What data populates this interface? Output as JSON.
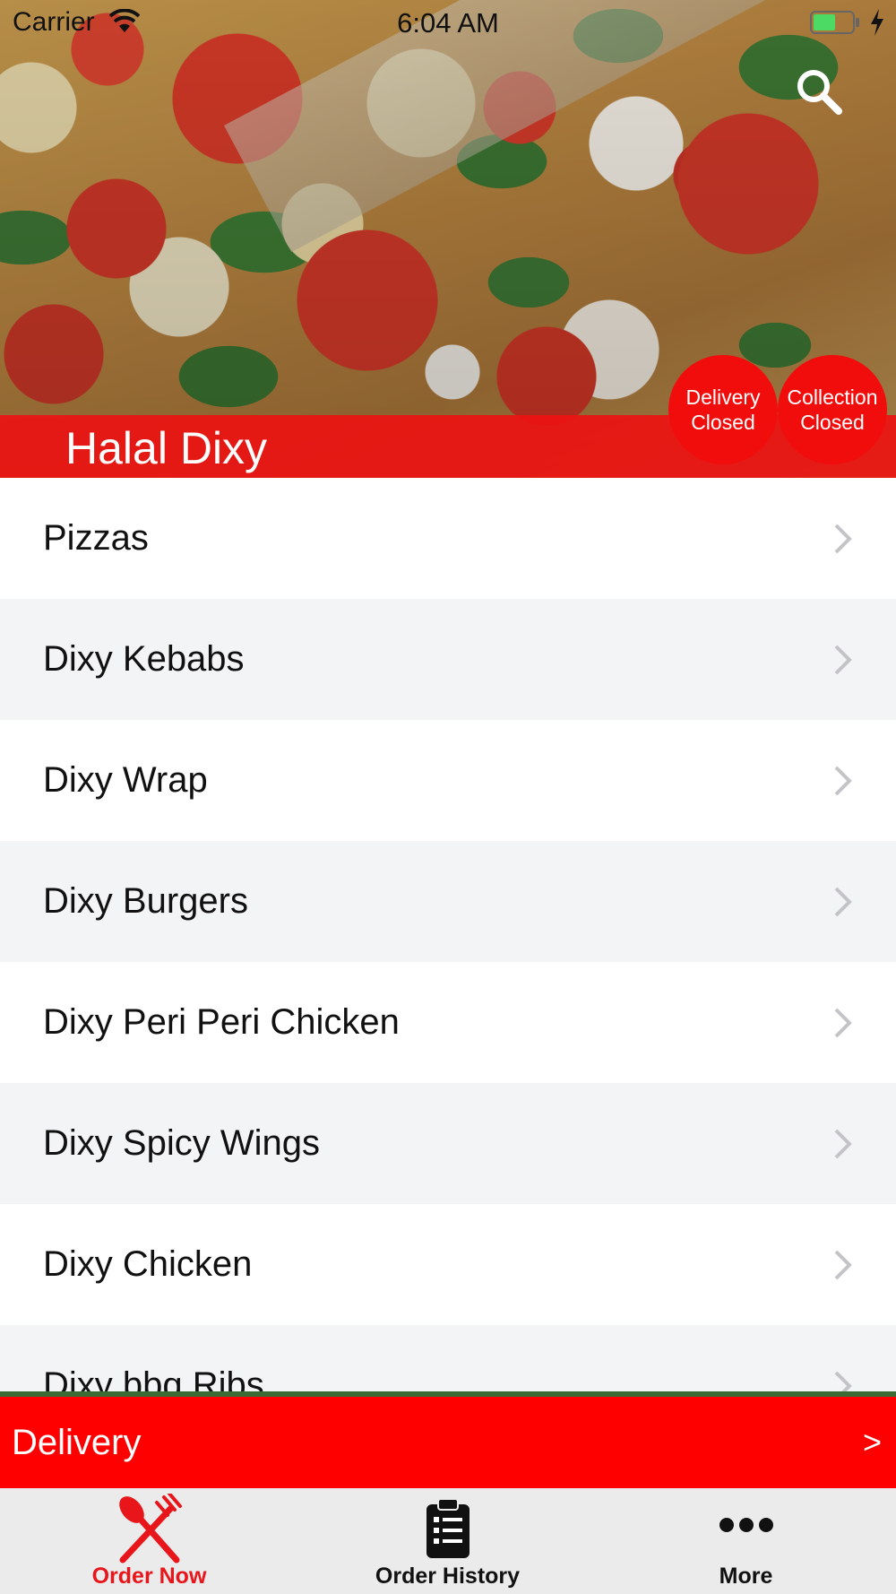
{
  "status_bar": {
    "carrier": "Carrier",
    "time": "6:04 AM",
    "battery_color": "#4cd964"
  },
  "header": {
    "search_icon": "search-icon",
    "restaurant_name": "Halal Dixy",
    "delivery_status": {
      "line1": "Delivery",
      "line2": "Closed"
    },
    "collection_status": {
      "line1": "Collection",
      "line2": "Closed"
    }
  },
  "menu": {
    "items": [
      {
        "label": "Pizzas"
      },
      {
        "label": "Dixy Kebabs"
      },
      {
        "label": "Dixy Wrap"
      },
      {
        "label": "Dixy Burgers"
      },
      {
        "label": "Dixy Peri Peri Chicken"
      },
      {
        "label": "Dixy Spicy Wings"
      },
      {
        "label": "Dixy Chicken"
      },
      {
        "label": "Dixy bbq Ribs"
      }
    ]
  },
  "delivery_bar": {
    "label": "Delivery",
    "arrow": ">"
  },
  "tab_bar": {
    "tabs": [
      {
        "label": "Order Now",
        "icon": "fork-knife-icon",
        "active": true
      },
      {
        "label": "Order History",
        "icon": "clipboard-list-icon",
        "active": false
      },
      {
        "label": "More",
        "icon": "more-dots-icon",
        "active": false
      }
    ]
  },
  "colors": {
    "brand_red": "#ff0000",
    "active_tab": "#e8161b",
    "row_alt": "#f3f4f6"
  }
}
